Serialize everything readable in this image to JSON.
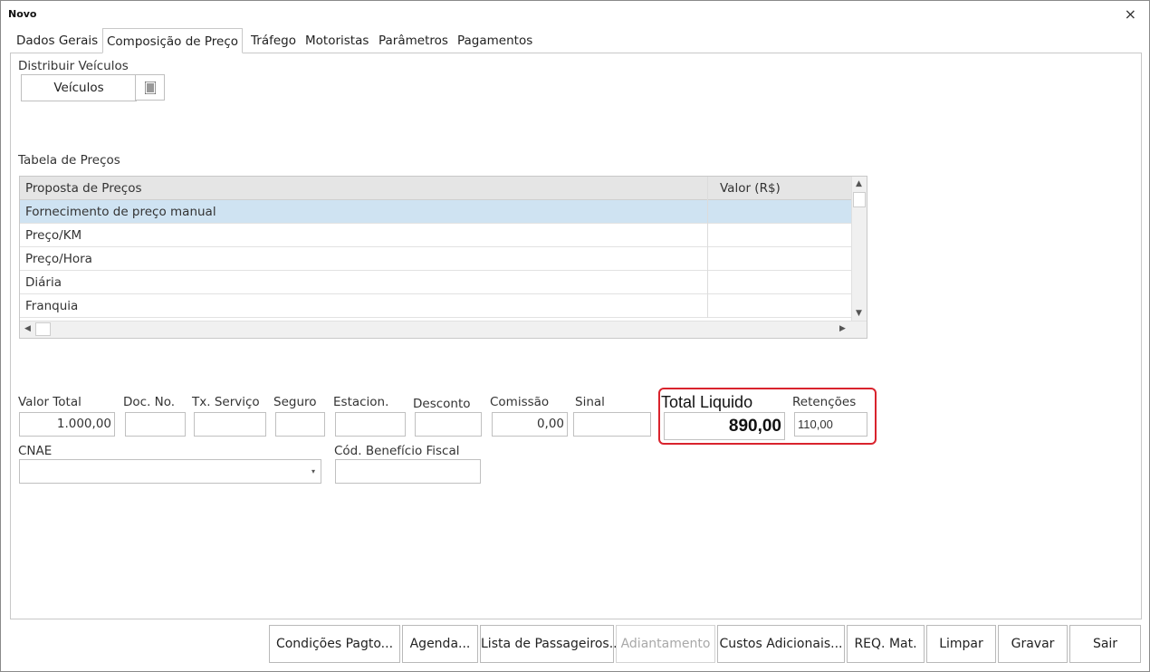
{
  "window": {
    "title": "Novo",
    "close_glyph": "×"
  },
  "tabs": [
    {
      "label": "Dados Gerais",
      "active": false
    },
    {
      "label": "Composição de Preço",
      "active": true
    },
    {
      "label": "Tráfego",
      "active": false
    },
    {
      "label": "Motoristas",
      "active": false
    },
    {
      "label": "Parâmetros",
      "active": false
    },
    {
      "label": "Pagamentos",
      "active": false
    }
  ],
  "distribuir": {
    "label": "Distribuir Veículos",
    "button_label": "Veículos",
    "list_icon": "list-icon"
  },
  "price_table": {
    "label": "Tabela de Preços",
    "columns": [
      "Proposta de Preços",
      "Valor (R$)"
    ],
    "rows": [
      {
        "name": "Fornecimento de preço manual",
        "value": "",
        "selected": true
      },
      {
        "name": "Preço/KM",
        "value": ""
      },
      {
        "name": "Preço/Hora",
        "value": ""
      },
      {
        "name": "Diária",
        "value": ""
      },
      {
        "name": "Franquia",
        "value": ""
      }
    ]
  },
  "totals": {
    "valor_total": {
      "label": "Valor Total",
      "value": "1.000,00"
    },
    "doc_no": {
      "label": "Doc. No.",
      "value": ""
    },
    "tx_servico": {
      "label": "Tx. Serviço",
      "value": ""
    },
    "seguro": {
      "label": "Seguro",
      "value": ""
    },
    "estacion": {
      "label": "Estacion.",
      "value": ""
    },
    "desconto": {
      "label": "Desconto",
      "value": ""
    },
    "comissao": {
      "label": "Comissão",
      "value": "0,00"
    },
    "sinal": {
      "label": "Sinal",
      "value": ""
    },
    "total_liquido": {
      "label": "Total Liquido",
      "value": "890,00"
    },
    "retencoes": {
      "label": "Retenções",
      "value": "110,00"
    }
  },
  "cnae": {
    "label": "CNAE",
    "value": ""
  },
  "cod_beneficio": {
    "label": "Cód. Benefício Fiscal",
    "value": ""
  },
  "bottom_buttons": [
    {
      "label": "Condições Pagto...",
      "enabled": true
    },
    {
      "label": "Agenda...",
      "enabled": true
    },
    {
      "label": "Lista de Passageiros...",
      "enabled": true
    },
    {
      "label": "Adiantamento",
      "enabled": false
    },
    {
      "label": "Custos Adicionais...",
      "enabled": true
    },
    {
      "label": "REQ. Mat.",
      "enabled": true
    },
    {
      "label": "Limpar",
      "enabled": true
    },
    {
      "label": "Gravar",
      "enabled": true
    },
    {
      "label": "Sair",
      "enabled": true
    }
  ],
  "colors": {
    "highlight": "#d9232d",
    "selected_row": "#cfe3f2"
  }
}
